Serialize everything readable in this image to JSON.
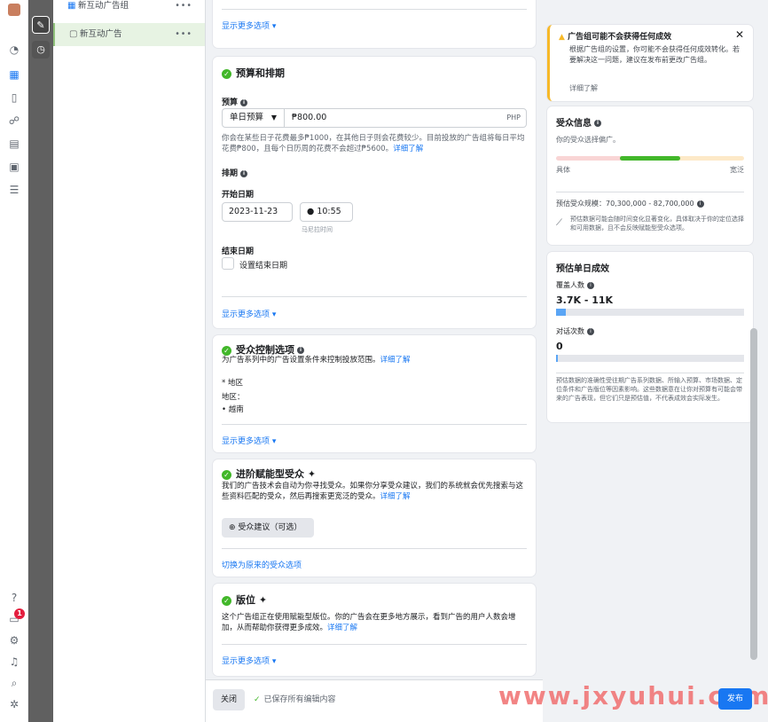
{
  "colors": {
    "accent": "#1877f2",
    "success": "#42b72a",
    "warning": "#f7b928",
    "alert": "#e41e3f"
  },
  "rail": {
    "icons": [
      "avatar-icon",
      "dashboard-icon",
      "grid-icon",
      "page-icon",
      "people-icon",
      "document-icon",
      "report-icon",
      "menu-icon",
      "help-icon",
      "notifications-icon",
      "settings-icon",
      "bell-icon",
      "search-icon",
      "bug-icon"
    ],
    "badge": "1"
  },
  "tree": {
    "campaign_label": "新互动广告组",
    "ad_label": "新互动广告"
  },
  "main": {
    "top_more": "显示更多选项 ▾",
    "budget": {
      "title": "预算和排期",
      "budget_label": "预算",
      "budget_type": "单日预算",
      "amount": "₱800.00",
      "currency": "PHP",
      "help_text": "你会在某些日子花费最多₱1000，在其他日子则会花费较少。目前投放的广告组将每日平均花费₱800，且每个日历周的花费不会超过₱5600。",
      "learn_more": "详细了解",
      "schedule_label": "排期",
      "start_label": "开始日期",
      "start_date": "2023-11-23",
      "start_time": "10:55",
      "timezone": "马尼拉时间",
      "end_label": "结束日期",
      "end_checkbox": "设置结束日期",
      "more": "显示更多选项 ▾"
    },
    "audience_controls": {
      "title": "受众控制选项",
      "subtitle": "为广告系列中的广告设置条件来控制投放范围。",
      "learn_more": "详细了解",
      "region_heading": "* 地区",
      "region_label": "地区：",
      "region_value": "• 越南",
      "more": "显示更多选项 ▾"
    },
    "advantage_audience": {
      "title": "进阶赋能型受众",
      "desc": "我们的广告技术会自动为你寻找受众。如果你分享受众建议，我们的系统就会优先搜索与这些资料匹配的受众，然后再搜索更宽泛的受众。",
      "learn_more": "详细了解",
      "suggest_button": "受众建议（可选）",
      "switch_link": "切换为原来的受众选项"
    },
    "placements": {
      "title": "版位",
      "desc": "这个广告组正在使用赋能型版位。你的广告会在更多地方展示，看到广告的用户人数会增加，从而帮助你获得更多成效。",
      "learn_more": "详细了解",
      "more": "显示更多选项 ▾"
    }
  },
  "bottom": {
    "close": "关闭",
    "saved": "已保存所有编辑内容",
    "publish": "发布"
  },
  "right": {
    "warning": {
      "title": "广告组可能不会获得任何成效",
      "text": "根据广告组的设置，你可能不会获得任何成效转化。若要解决这一问题，建议在发布前更改广告组。",
      "learn_more": "详细了解"
    },
    "audience_info": {
      "title": "受众信息",
      "subtitle": "你的受众选择偏广。",
      "left_label": "具体",
      "right_label": "宽泛",
      "size_label": "预估受众规模：",
      "size_value": "70,300,000 - 82,700,000",
      "note": "预估数据可能会随时间变化显著变化，具体取决于你的定位选择和可用数据，且不会反映赋能型受众选项。"
    },
    "daily_results": {
      "title": "预估单日成效",
      "reach_label": "覆盖人数",
      "reach_value": "3.7K - 11K",
      "reach_fill": 0.05,
      "conv_label": "对话次数",
      "conv_value": "0",
      "conv_fill": 0.0,
      "note": "预估数据的准确性受往期广告系列数据、所输入预算、市场数据、定位条件和广告版位等因素影响。这些数据意在让你对预算有可能会带来的广告表现，但它们只是预估值，不代表成效会实际发生。"
    }
  },
  "watermark": "www.jxyuhui.com"
}
